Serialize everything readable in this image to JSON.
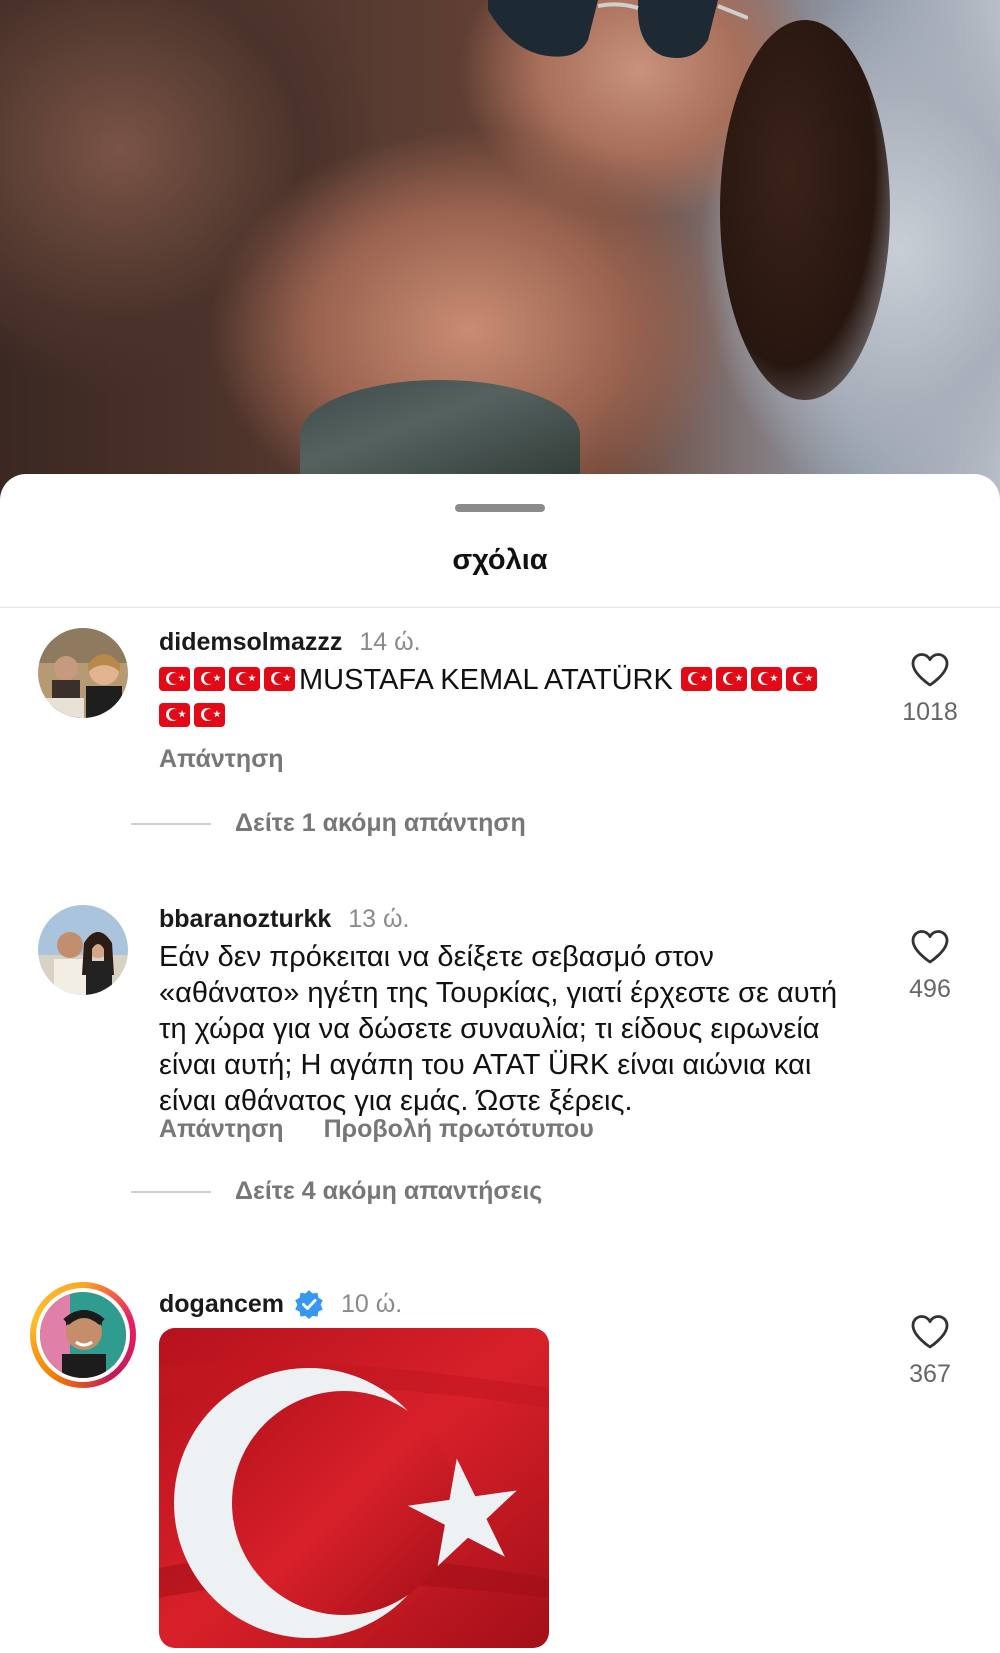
{
  "sheet": {
    "title": "σχόλια"
  },
  "comments": [
    {
      "username": "didemsolmazzz",
      "time": "14 ώ.",
      "text_prefix_flags": 4,
      "text_main": "MUSTAFA KEMAL ATATÜRK",
      "text_suffix_flags_line1": 4,
      "text_suffix_flags_line2": 2,
      "reply_label": "Απάντηση",
      "likes": "1018",
      "more_replies": "Δείτε 1 ακόμη απάντηση"
    },
    {
      "username": "bbaranozturkk",
      "time": "13 ώ.",
      "text": "Εάν δεν πρόκειται να δείξετε σεβασμό στον «αθάνατο» ηγέτη της Τουρκίας, γιατί έρχεστε σε αυτή τη χώρα για να δώσετε συναυλία; τι είδους ειρωνεία είναι αυτή; Η αγάπη του ATAT ÜRK είναι αιώνια και είναι αθάνατος για εμάς. Ώστε ξέρεις.",
      "reply_label": "Απάντηση",
      "original_label": "Προβολή πρωτότυπου",
      "likes": "496",
      "more_replies": "Δείτε 4 ακόμη απαντήσεις"
    },
    {
      "username": "dogancem",
      "verified": true,
      "time": "10 ώ.",
      "likes": "367",
      "media": "turkish-flag-image"
    }
  ],
  "colors": {
    "flag_red": "#e30a17",
    "verified_blue": "#3897f0",
    "secondary_text": "#8a8a8a"
  }
}
